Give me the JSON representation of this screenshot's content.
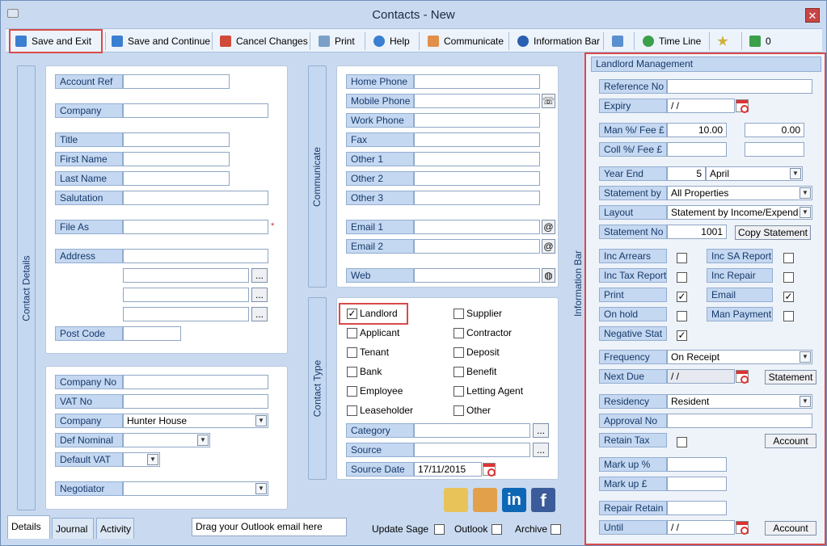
{
  "window": {
    "title": "Contacts  - New",
    "close": "✕"
  },
  "toolbar": [
    {
      "label": "Save and Exit",
      "color": "#3a7fd0"
    },
    {
      "label": "Save and Continue",
      "color": "#3a7fd0"
    },
    {
      "label": "Cancel Changes",
      "color": "#d04a3a"
    },
    {
      "label": "Print",
      "color": "#7aa0c8"
    },
    {
      "label": "Help",
      "color": "#3a7fd0"
    },
    {
      "label": "Communicate",
      "color": "#e0904a"
    },
    {
      "label": "Information Bar",
      "color": "#2a5fb0"
    },
    {
      "label": "",
      "color": "#5a8fd0"
    },
    {
      "label": "Time Line",
      "color": "#3aa04a"
    },
    {
      "label": "",
      "color": "#d0b03a"
    },
    {
      "label": "0",
      "color": "#3aa04a"
    }
  ],
  "contact_details": {
    "title": "Contact Details",
    "account_ref": "Account Ref",
    "company": "Company",
    "title_lbl": "Title",
    "first_name": "First Name",
    "last_name": "Last Name",
    "salutation": "Salutation",
    "file_as": "File As",
    "address": "Address",
    "post_code": "Post Code",
    "required": "*",
    "ellipsis": "...",
    "company_no": "Company No",
    "vat_no": "VAT No",
    "company2": "Company",
    "company2_value": "Hunter House",
    "def_nominal": "Def Nominal",
    "default_vat": "Default VAT",
    "negotiator": "Negotiator"
  },
  "communicate": {
    "title": "Communicate",
    "home_phone": "Home Phone",
    "mobile_phone": "Mobile Phone",
    "work_phone": "Work Phone",
    "fax": "Fax",
    "other1": "Other 1",
    "other2": "Other 2",
    "other3": "Other 3",
    "email1": "Email 1",
    "email2": "Email 2",
    "web": "Web"
  },
  "contact_type": {
    "title": "Contact Type",
    "items": [
      {
        "label": "Landlord",
        "checked": true
      },
      {
        "label": "Supplier",
        "checked": false
      },
      {
        "label": "Applicant",
        "checked": false
      },
      {
        "label": "Contractor",
        "checked": false
      },
      {
        "label": "Tenant",
        "checked": false
      },
      {
        "label": "Deposit",
        "checked": false
      },
      {
        "label": "Bank",
        "checked": false
      },
      {
        "label": "Benefit",
        "checked": false
      },
      {
        "label": "Employee",
        "checked": false
      },
      {
        "label": "Letting Agent",
        "checked": false
      },
      {
        "label": "Leaseholder",
        "checked": false
      },
      {
        "label": "Other",
        "checked": false
      }
    ],
    "category": "Category",
    "source": "Source",
    "source_date": "Source Date",
    "source_date_value": "17/11/2015"
  },
  "landlord": {
    "bar_title": "Information Bar",
    "title": "Landlord Management",
    "reference_no": "Reference No",
    "expiry": "Expiry",
    "expiry_value": " /  /",
    "man_fee": "Man %/ Fee £",
    "man_pct": "10.00",
    "man_fee_value": "0.00",
    "coll_fee": "Coll %/ Fee £",
    "year_end": "Year End",
    "year_end_day": "5",
    "year_end_month": "April",
    "statement_by": "Statement by",
    "statement_by_value": "All Properties",
    "layout": "Layout",
    "layout_value": "Statement by Income/Expend",
    "statement_no": "Statement No",
    "statement_no_value": "1001",
    "copy_statement": "Copy Statement",
    "inc_arrears": "Inc Arrears",
    "inc_sa_report": "Inc SA Report",
    "inc_tax_report": "Inc Tax Report",
    "inc_repair": "Inc Repair",
    "print": "Print",
    "email": "Email",
    "on_hold": "On hold",
    "man_payment": "Man Payment",
    "negative_stat": "Negative Stat",
    "frequency": "Frequency",
    "frequency_value": "On Receipt",
    "next_due": "Next Due",
    "next_due_value": " /  /",
    "statement_btn": "Statement",
    "residency": "Residency",
    "residency_value": "Resident",
    "approval_no": "Approval No",
    "retain_tax": "Retain Tax",
    "account_btn": "Account",
    "markup_pct": "Mark up %",
    "markup_gbp": "Mark up £",
    "repair_retain": "Repair Retain",
    "until": "Until",
    "until_value": " /  /",
    "account_btn2": "Account"
  },
  "bottom": {
    "tabs": [
      "Details",
      "Journal",
      "Activity"
    ],
    "drag_text": "Drag your Outlook email here",
    "update_sage": "Update Sage",
    "outlook": "Outlook",
    "archive": "Archive"
  },
  "social": [
    {
      "name": "map-icon",
      "color": "#e8c35a"
    },
    {
      "name": "pin-map-icon",
      "color": "#e3a04a"
    },
    {
      "name": "linkedin-icon",
      "color": "#0e67b4",
      "text": "in"
    },
    {
      "name": "facebook-icon",
      "color": "#3b5b9a",
      "text": "f"
    }
  ]
}
